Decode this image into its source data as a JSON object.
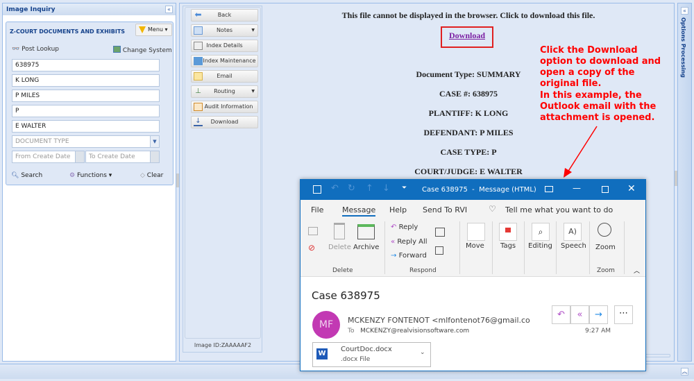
{
  "left_panel": {
    "title": "Image Inquiry",
    "section_title": "Z-COURT DOCUMENTS AND EXHIBITS",
    "menu_label": "Menu",
    "post_lookup": "Post Lookup",
    "change_system": "Change System",
    "fields": [
      "638975",
      "K LONG",
      "P MILES",
      "P",
      "E WALTER"
    ],
    "document_type_placeholder": "DOCUMENT TYPE",
    "from_date_placeholder": "From Create Date",
    "to_date_placeholder": "To Create Date",
    "search": "Search",
    "functions": "Functions",
    "clear": "Clear"
  },
  "toolbar": {
    "buttons": [
      "Back",
      "Notes",
      "Index Details",
      "Index Maintenance",
      "Email",
      "Routing",
      "Audit Information",
      "Download"
    ],
    "image_id": "Image ID:ZAAAAAF2"
  },
  "document": {
    "message": "This file cannot be displayed in the browser. Click to download this file.",
    "download_link": "Download",
    "lines": [
      "Document Type: SUMMARY",
      "CASE #: 638975",
      "PLANTIFF: K LONG",
      "DEFENDANT: P MILES",
      "CASE TYPE: P",
      "COURT/JUDGE: E WALTER"
    ]
  },
  "annotation": {
    "line1": "Click the Download option to download and open a copy of the original file.",
    "line2": "In this example, the Outlook email with the attachment is opened."
  },
  "right_panel": {
    "title": "Options Processing"
  },
  "outlook": {
    "title": "Case 638975  -  Message (HTML)",
    "menu": [
      "File",
      "Message",
      "Help",
      "Send To RVI"
    ],
    "tell_me": "Tell me what you want to do",
    "ribbon": {
      "delete": "Delete",
      "archive": "Archive",
      "reply": "Reply",
      "reply_all": "Reply All",
      "forward": "Forward",
      "move": "Move",
      "tags": "Tags",
      "editing": "Editing",
      "speech": "Speech",
      "zoom": "Zoom",
      "groups": {
        "delete": "Delete",
        "respond": "Respond",
        "zoom": "Zoom"
      }
    },
    "subject": "Case 638975",
    "avatar_initials": "MF",
    "sender": "MCKENZY FONTENOT <mlfontenot76@gmail.co",
    "to_label": "To",
    "to": "MCKENZY@realvisionsoftware.com",
    "time": "9:27 AM",
    "attachment": {
      "name": "CourtDoc.docx",
      "type": ".docx File"
    }
  },
  "colors": {
    "accent": "#106ebe",
    "annotation": "#ff0000",
    "avatar": "#c239b3"
  }
}
